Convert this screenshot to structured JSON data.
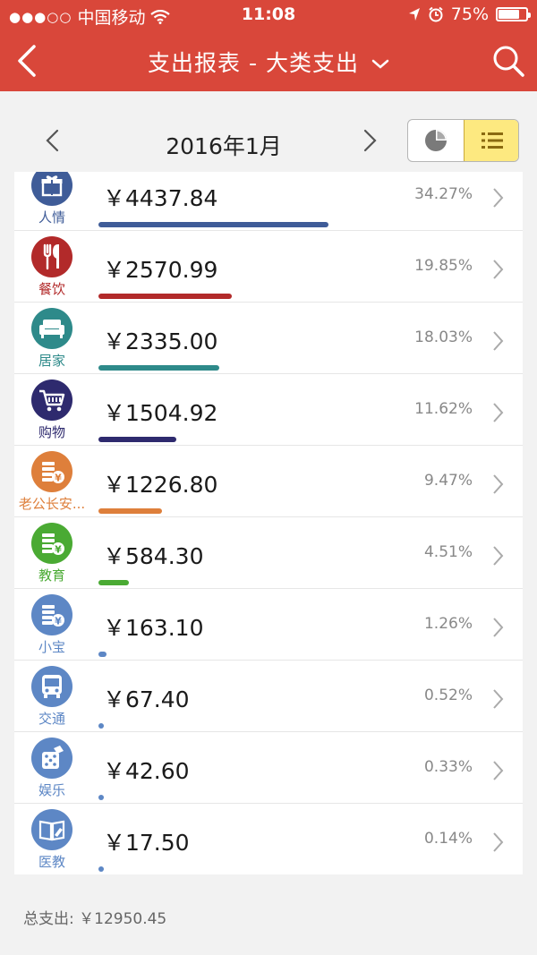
{
  "status": {
    "carrier": "中国移动",
    "time": "11:08",
    "battery": "75%",
    "icons": [
      "signal-dots-icon",
      "wifi-icon",
      "location-arrow-icon",
      "alarm-icon",
      "battery-icon"
    ]
  },
  "nav": {
    "title": "支出报表 - 大类支出",
    "back_icon": "back-chevron-icon",
    "dropdown_icon": "chevron-down-icon",
    "search_icon": "search-icon"
  },
  "period": {
    "label": "2016年1月",
    "prev_icon": "chevron-left-icon",
    "next_icon": "chevron-right-icon"
  },
  "view_toggle": {
    "options": [
      "pie-chart-view",
      "list-view"
    ],
    "selected": "list-view"
  },
  "categories": [
    {
      "name": "人情",
      "amount": "￥4437.84",
      "percent": "34.27%",
      "share": 0.3427,
      "color": "#3f5c98",
      "icon": "gift-icon"
    },
    {
      "name": "餐饮",
      "amount": "￥2570.99",
      "percent": "19.85%",
      "share": 0.1985,
      "color": "#b22a2a",
      "icon": "fork-knife-icon"
    },
    {
      "name": "居家",
      "amount": "￥2335.00",
      "percent": "18.03%",
      "share": 0.1803,
      "color": "#2e8a8a",
      "icon": "sofa-icon"
    },
    {
      "name": "购物",
      "amount": "￥1504.92",
      "percent": "11.62%",
      "share": 0.1162,
      "color": "#2e2a6e",
      "icon": "shopping-cart-icon"
    },
    {
      "name": "老公长安...",
      "amount": "￥1226.80",
      "percent": "9.47%",
      "share": 0.0947,
      "color": "#de7f3b",
      "icon": "coins-yen-icon"
    },
    {
      "name": "教育",
      "amount": "￥584.30",
      "percent": "4.51%",
      "share": 0.0451,
      "color": "#4aaa33",
      "icon": "coins-yen-icon"
    },
    {
      "name": "小宝",
      "amount": "￥163.10",
      "percent": "1.26%",
      "share": 0.0126,
      "color": "#5d87c5",
      "icon": "coins-yen-icon"
    },
    {
      "name": "交通",
      "amount": "￥67.40",
      "percent": "0.52%",
      "share": 0.0052,
      "color": "#5d87c5",
      "icon": "bus-icon"
    },
    {
      "name": "娱乐",
      "amount": "￥42.60",
      "percent": "0.33%",
      "share": 0.0033,
      "color": "#5d87c5",
      "icon": "dice-icon"
    },
    {
      "name": "医教",
      "amount": "￥17.50",
      "percent": "0.14%",
      "share": 0.0014,
      "color": "#5d87c5",
      "icon": "book-icon"
    }
  ],
  "total": "总支出: ￥12950.45"
}
